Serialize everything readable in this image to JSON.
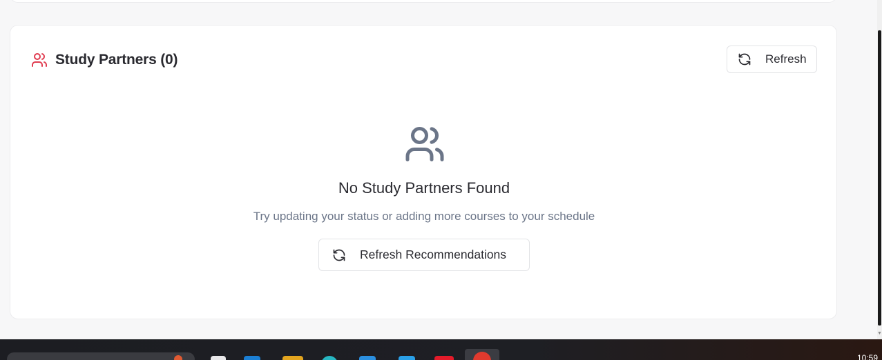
{
  "partners": {
    "title": "Study Partners (0)",
    "refresh_label": "Refresh",
    "empty_title": "No Study Partners Found",
    "empty_subtitle": "Try updating your status or adding more courses to your schedule",
    "refresh_recommendations_label": "Refresh Recommendations",
    "header_icon": "users-icon",
    "empty_icon": "users-icon",
    "refresh_icon": "refresh-icon",
    "accent_color": "#e03a4e"
  },
  "taskbar": {
    "clock": "10:59",
    "apps": [
      "file-icon",
      "edge-icon",
      "folder-icon",
      "chrome-icon",
      "store-icon",
      "vscode-icon",
      "office-icon",
      "app-icon"
    ]
  }
}
